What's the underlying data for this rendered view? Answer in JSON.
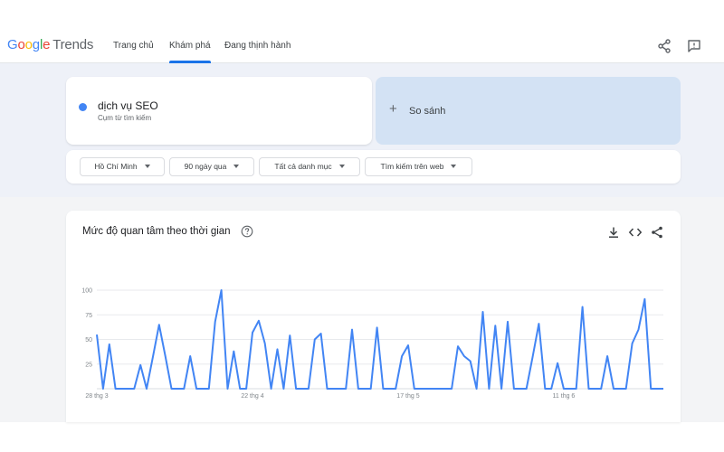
{
  "app": {
    "logo_parts": [
      "G",
      "o",
      "o",
      "g",
      "l",
      "e"
    ],
    "logo_suffix": "Trends"
  },
  "nav": {
    "home": "Trang chủ",
    "explore": "Khám phá",
    "trending": "Đang thịnh hành",
    "active": "explore"
  },
  "search": {
    "term": "dịch vụ SEO",
    "term_type": "Cụm từ tìm kiếm",
    "compare_label": "So sánh"
  },
  "filters": {
    "region": "Hồ Chí Minh",
    "period": "90 ngày qua",
    "category": "Tất cả danh mục",
    "search_type": "Tìm kiếm trên web"
  },
  "chart_section": {
    "title": "Mức độ quan tâm theo thời gian"
  },
  "colors": {
    "accent": "#1a73e8",
    "series": "#4285f4",
    "band": "#eef1f8",
    "compare_bg": "#d3e2f4"
  },
  "icons": [
    "share-icon",
    "feedback-icon",
    "help-icon",
    "download-icon",
    "embed-icon"
  ],
  "chart_data": {
    "type": "line",
    "title": "Mức độ quan tâm theo thời gian",
    "xlabel": "",
    "ylabel": "",
    "ylim": [
      0,
      100
    ],
    "yticks": [
      25,
      50,
      75,
      100
    ],
    "xtick_labels": [
      "28 thg 3",
      "22 thg 4",
      "17 thg 5",
      "11 thg 6"
    ],
    "xtick_index": [
      0,
      25,
      50,
      75
    ],
    "grid": true,
    "series": [
      {
        "values": [
          55,
          0,
          45,
          0,
          0,
          0,
          0,
          24,
          0,
          32,
          65,
          33,
          0,
          0,
          0,
          33,
          0,
          0,
          0,
          68,
          100,
          0,
          38,
          0,
          0,
          57,
          69,
          46,
          0,
          40,
          0,
          54,
          0,
          0,
          0,
          50,
          56,
          0,
          0,
          0,
          0,
          60,
          0,
          0,
          0,
          62,
          0,
          0,
          0,
          33,
          44,
          0,
          0,
          0,
          0,
          0,
          0,
          0,
          43,
          33,
          28,
          0,
          78,
          0,
          64,
          0,
          68,
          0,
          0,
          0,
          32,
          66,
          0,
          0,
          26,
          0,
          0,
          0,
          83,
          0,
          0,
          0,
          33,
          0,
          0,
          0,
          46,
          60,
          91,
          0,
          0,
          0
        ]
      }
    ]
  }
}
